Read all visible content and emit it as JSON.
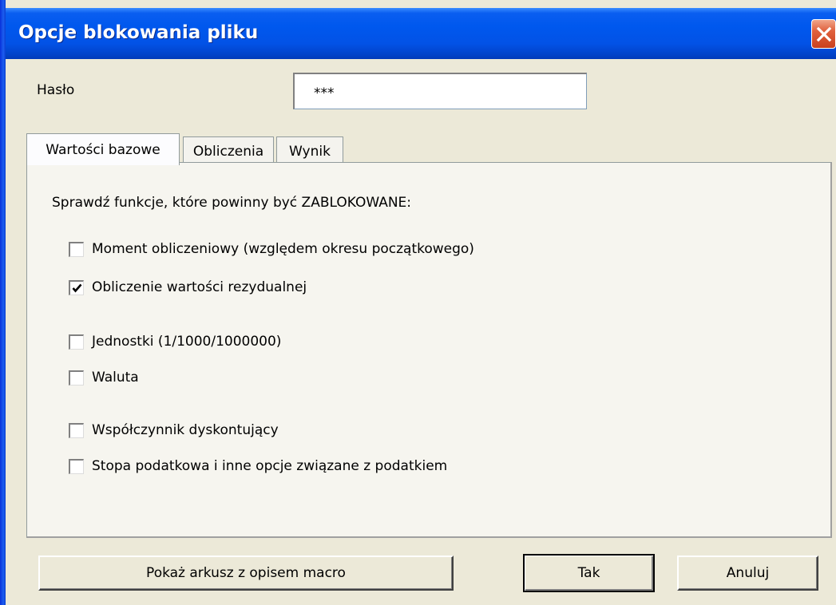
{
  "window": {
    "title": "Opcje blokowania pliku"
  },
  "password": {
    "label": "Hasło",
    "value": "***"
  },
  "tabs": [
    {
      "label": "Wartości bazowe",
      "active": true
    },
    {
      "label": "Obliczenia",
      "active": false
    },
    {
      "label": "Wynik",
      "active": false
    }
  ],
  "panel": {
    "instruction": "Sprawdź funkcje, które powinny być ZABLOKOWANE:",
    "options": [
      {
        "label": "Moment obliczeniowy (względem okresu początkowego)",
        "checked": false
      },
      {
        "label": "Obliczenie wartości rezydualnej",
        "checked": true
      },
      {
        "label": "Jednostki (1/1000/1000000)",
        "checked": false
      },
      {
        "label": "Waluta",
        "checked": false
      },
      {
        "label": "Współczynnik dyskontujący",
        "checked": false
      },
      {
        "label": "Stopa podatkowa i inne opcje związane z podatkiem",
        "checked": false
      }
    ]
  },
  "buttons": {
    "show_macro": "Pokaż arkusz z opisem macro",
    "ok": "Tak",
    "cancel": "Anuluj"
  },
  "icons": {
    "close": "close-icon",
    "check": "checkmark-icon"
  },
  "colors": {
    "titlebar": "#0058EE",
    "close": "#E0603C",
    "face": "#ECE9D8"
  }
}
